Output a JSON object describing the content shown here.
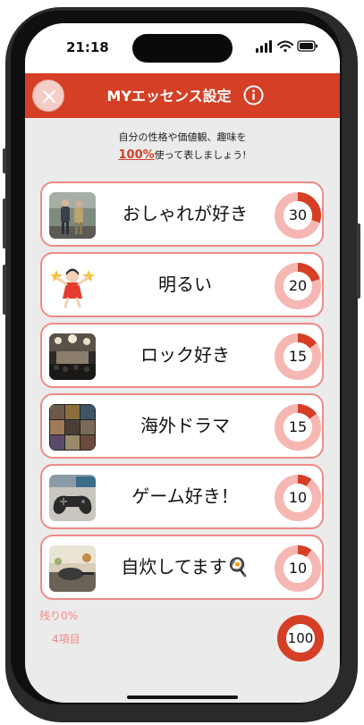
{
  "status_bar": {
    "time": "21:18"
  },
  "header": {
    "title": "MYエッセンス設定"
  },
  "intro": {
    "line1": "自分の性格や価値観、趣味を",
    "percent": "100%",
    "line2_rest": "使って表しましょう!"
  },
  "items": [
    {
      "label": "おしゃれが好き",
      "value": "30",
      "fraction": 0.3
    },
    {
      "label": "明るい",
      "value": "20",
      "fraction": 0.2
    },
    {
      "label": "ロック好き",
      "value": "15",
      "fraction": 0.15
    },
    {
      "label": "海外ドラマ",
      "value": "15",
      "fraction": 0.15
    },
    {
      "label": "ゲーム好き！",
      "value": "10",
      "fraction": 0.1
    },
    {
      "label": "自炊してます🍳",
      "value": "10",
      "fraction": 0.1
    }
  ],
  "footer": {
    "remaining": "残り0%",
    "item_count": "4項目",
    "total": "100",
    "total_fraction": 1.0
  },
  "colors": {
    "accent": "#d43f25",
    "ring_track": "#f6b7b3",
    "card_border": "#f08a86",
    "background": "#ebebeb"
  }
}
